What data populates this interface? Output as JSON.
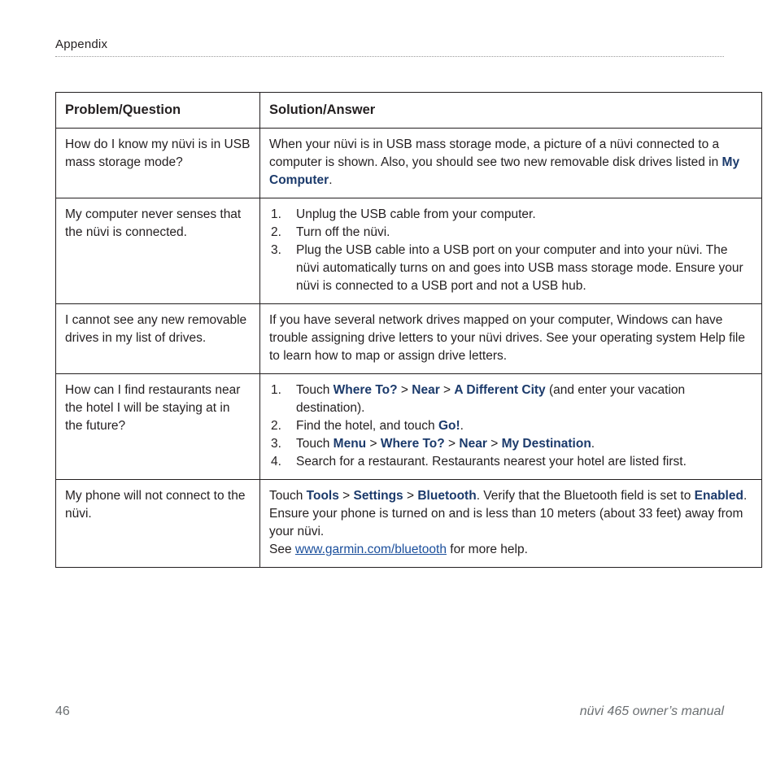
{
  "header": {
    "title": "Appendix"
  },
  "table": {
    "columns": [
      "Problem/Question",
      "Solution/Answer"
    ],
    "rows": [
      {
        "question": "How do I know my nüvi is in USB mass storage mode?",
        "answer_parts": [
          {
            "t": "When your nüvi is in USB mass storage mode, a picture of a nüvi connected to a computer is shown. Also, you should see two new removable disk drives listed in ",
            "style": "normal"
          },
          {
            "t": "My Computer",
            "style": "bold"
          },
          {
            "t": ".",
            "style": "normal"
          }
        ]
      },
      {
        "question": "My computer never senses that the nüvi is connected.",
        "steps": [
          [
            {
              "t": "Unplug the USB cable from your computer.",
              "style": "normal"
            }
          ],
          [
            {
              "t": "Turn off the nüvi.",
              "style": "normal"
            }
          ],
          [
            {
              "t": "Plug the USB cable into a USB port on your computer and into your nüvi. The nüvi automatically turns on and goes into USB mass storage mode. Ensure your nüvi is connected to a USB port and not a USB hub.",
              "style": "normal"
            }
          ]
        ]
      },
      {
        "question": "I cannot see any new removable drives in my list of drives.",
        "answer_parts": [
          {
            "t": "If you have several network drives mapped on your computer, Windows can have trouble assigning drive letters to your nüvi drives. See your operating system Help file to learn how to map or assign drive letters.",
            "style": "normal"
          }
        ]
      },
      {
        "question": "How can I find restaurants near the hotel I will be staying at in the future?",
        "steps": [
          [
            {
              "t": "Touch ",
              "style": "normal"
            },
            {
              "t": "Where To?",
              "style": "bold"
            },
            {
              "t": " > ",
              "style": "normal"
            },
            {
              "t": "Near",
              "style": "bold"
            },
            {
              "t": " > ",
              "style": "normal"
            },
            {
              "t": "A Different City",
              "style": "bold"
            },
            {
              "t": " (and enter your vacation destination).",
              "style": "normal"
            }
          ],
          [
            {
              "t": "Find the hotel, and touch ",
              "style": "normal"
            },
            {
              "t": "Go!",
              "style": "bold"
            },
            {
              "t": ".",
              "style": "normal"
            }
          ],
          [
            {
              "t": "Touch ",
              "style": "normal"
            },
            {
              "t": "Menu",
              "style": "bold"
            },
            {
              "t": " > ",
              "style": "normal"
            },
            {
              "t": "Where To?",
              "style": "bold"
            },
            {
              "t": " > ",
              "style": "normal"
            },
            {
              "t": "Near",
              "style": "bold"
            },
            {
              "t": " > ",
              "style": "normal"
            },
            {
              "t": "My Destination",
              "style": "bold"
            },
            {
              "t": ".",
              "style": "normal"
            }
          ],
          [
            {
              "t": "Search for a restaurant. Restaurants nearest your hotel are listed first.",
              "style": "normal"
            }
          ]
        ]
      },
      {
        "question": "My phone will not connect to the nüvi.",
        "paragraphs": [
          [
            {
              "t": "Touch ",
              "style": "normal"
            },
            {
              "t": "Tools",
              "style": "bold"
            },
            {
              "t": " > ",
              "style": "normal"
            },
            {
              "t": "Settings",
              "style": "bold"
            },
            {
              "t": " > ",
              "style": "normal"
            },
            {
              "t": "Bluetooth",
              "style": "bold"
            },
            {
              "t": ". Verify that the Bluetooth field is set to ",
              "style": "normal"
            },
            {
              "t": "Enabled",
              "style": "bold"
            },
            {
              "t": ".",
              "style": "normal"
            }
          ],
          [
            {
              "t": "Ensure your phone is turned on and is less than 10 meters (about 33 feet) away from your nüvi.",
              "style": "normal"
            }
          ],
          [
            {
              "t": "See ",
              "style": "normal"
            },
            {
              "t": "www.garmin.com/bluetooth",
              "style": "link"
            },
            {
              "t": " for more help.",
              "style": "normal"
            }
          ]
        ]
      }
    ]
  },
  "footer": {
    "page_number": "46",
    "note": "nüvi 465 owner’s manual"
  },
  "colors": {
    "text": "#231f20",
    "bold_accent": "#1b3a6b",
    "link": "#1b4f9c",
    "footer": "#6b6f72",
    "border": "#231f20"
  }
}
